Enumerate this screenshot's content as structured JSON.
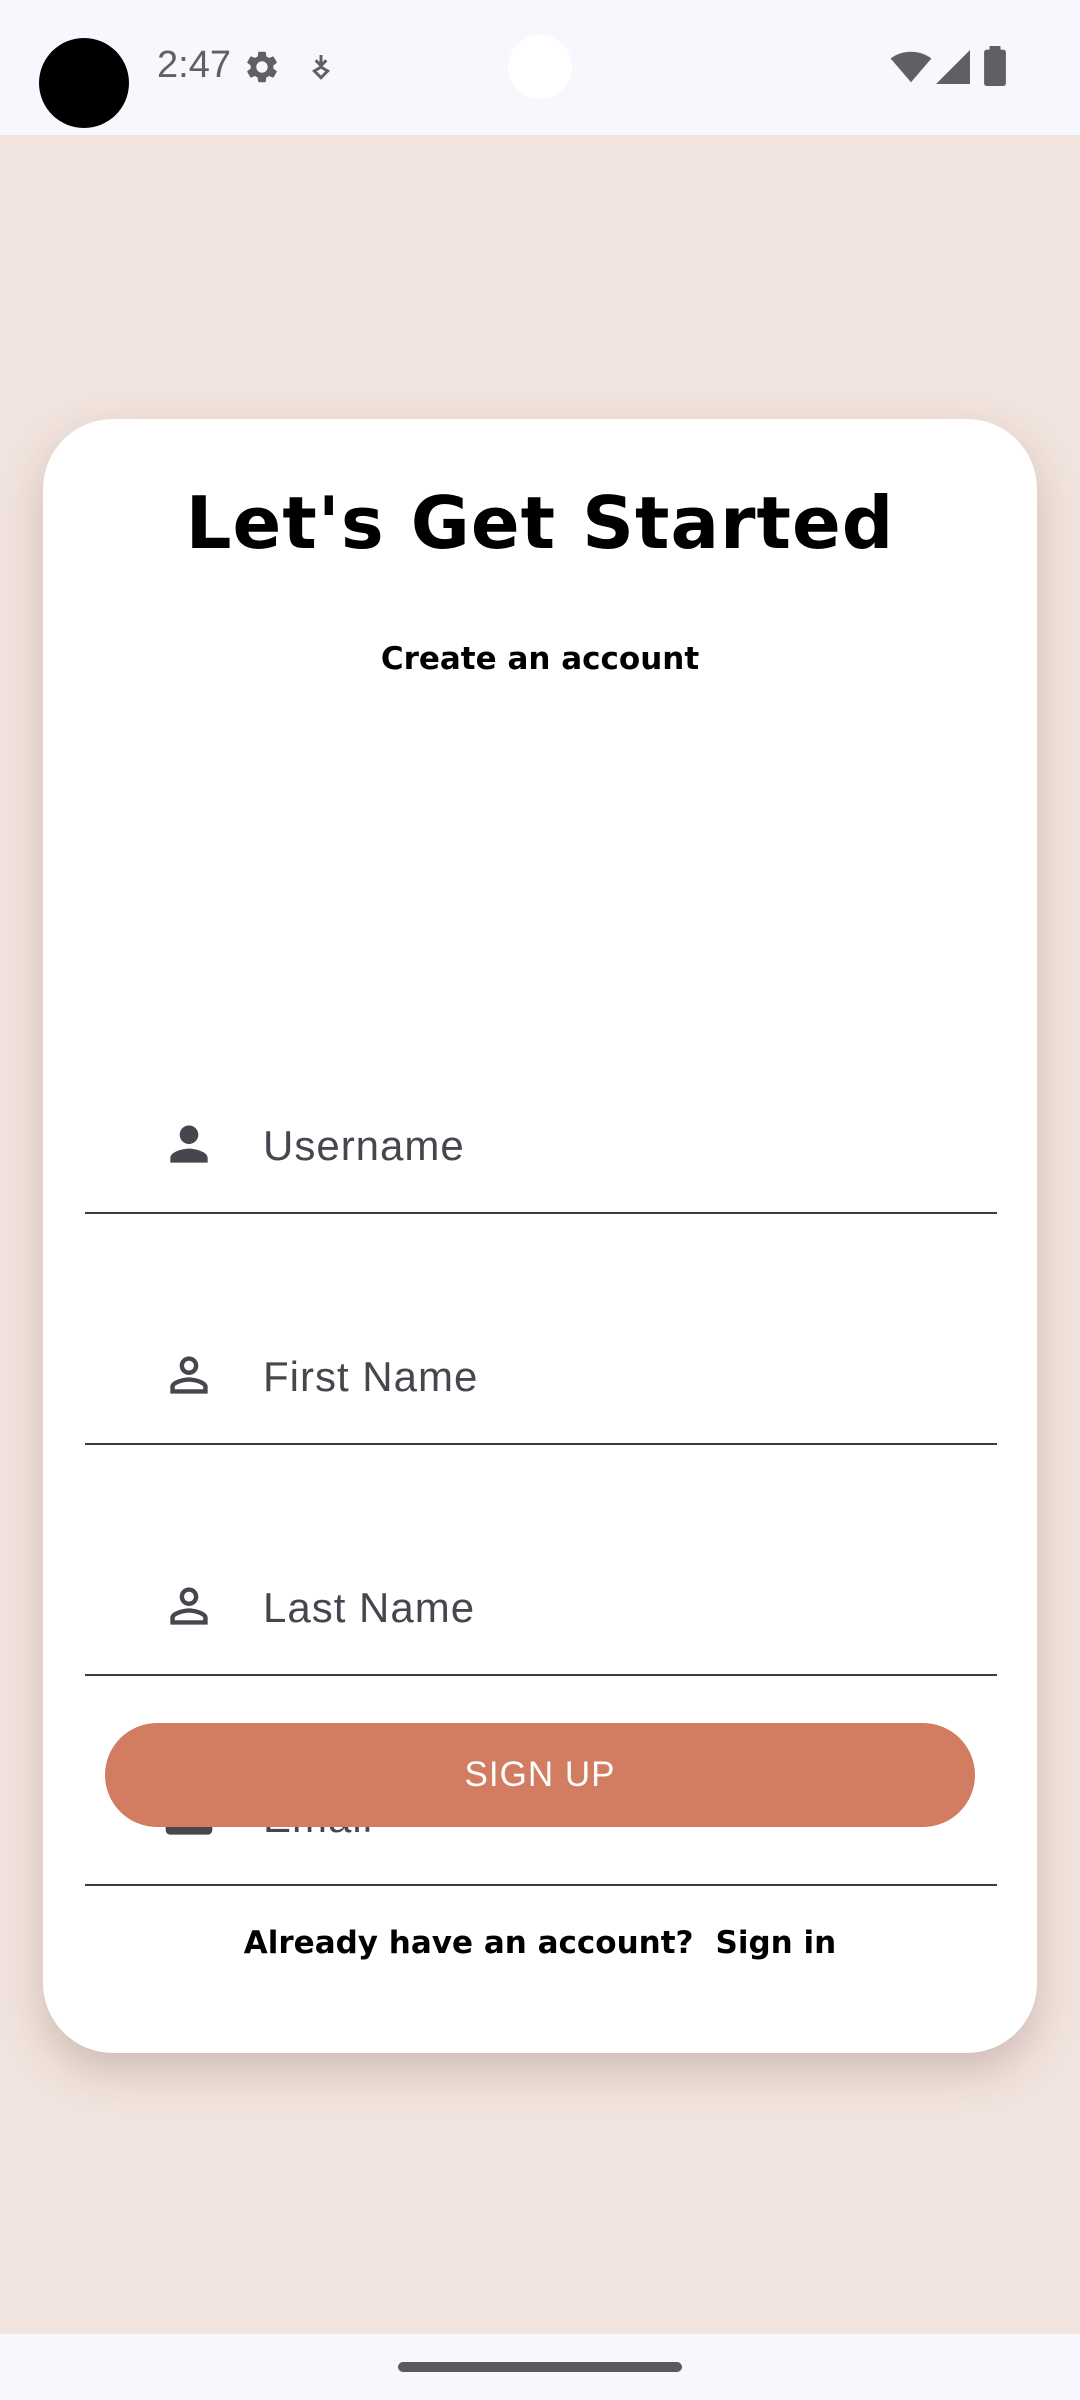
{
  "status_bar": {
    "time": "2:47",
    "icons": [
      "settings-gear-icon",
      "download-icon",
      "wifi-icon",
      "cell-signal-icon",
      "battery-icon"
    ]
  },
  "form": {
    "title": "Let's Get Started",
    "subtitle": "Create an account",
    "fields": [
      {
        "placeholder": "Username",
        "value": "",
        "icon": "person-filled-icon"
      },
      {
        "placeholder": "First Name",
        "value": "",
        "icon": "person-outline-icon"
      },
      {
        "placeholder": "Last Name",
        "value": "",
        "icon": "person-outline-icon"
      },
      {
        "placeholder": "Email",
        "value": "",
        "icon": "mail-icon"
      }
    ],
    "signup_label": "SIGN UP",
    "account_prompt": "Already have an account?",
    "signin_label": "Sign in"
  },
  "colors": {
    "background": "#F1E3DD",
    "card": "#FFFFFF",
    "accent": "#D27C62",
    "status_bar": "#F7F8FD",
    "icon": "#46464E"
  }
}
